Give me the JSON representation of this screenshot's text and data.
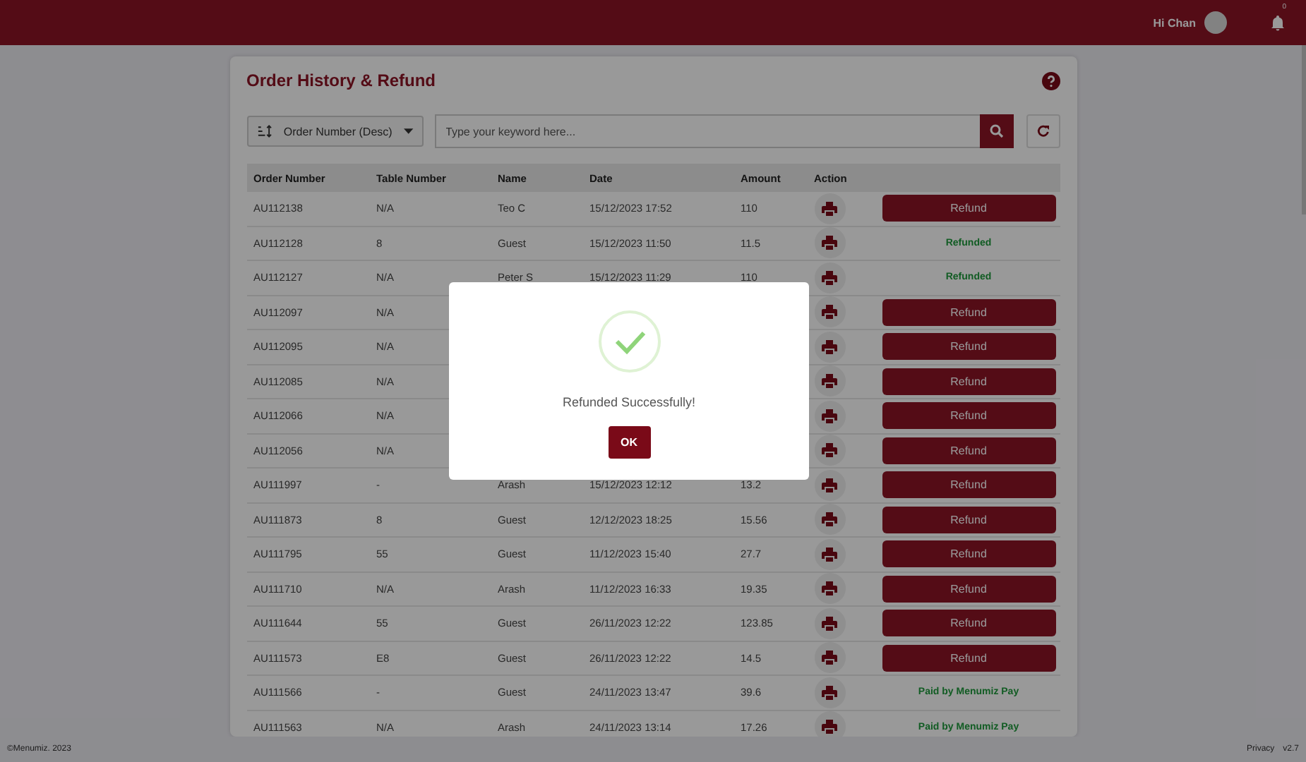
{
  "header": {
    "greeting": "Hi Chan",
    "notification_count": "0"
  },
  "page": {
    "title": "Order History & Refund"
  },
  "toolbar": {
    "sort": "Order Number (Desc)",
    "search_placeholder": "Type your keyword here..."
  },
  "table": {
    "columns": [
      "Order Number",
      "Table Number",
      "Name",
      "Date",
      "Amount",
      "Action"
    ],
    "rows": [
      {
        "order": "AU112138",
        "table": "N/A",
        "name": "Teo C",
        "date": "15/12/2023 17:52",
        "amount": "110",
        "kind": "refund",
        "action": "Refund"
      },
      {
        "order": "AU112128",
        "table": "8",
        "name": "Guest",
        "date": "15/12/2023 11:50",
        "amount": "11.5",
        "kind": "status",
        "action": "Refunded"
      },
      {
        "order": "AU112127",
        "table": "N/A",
        "name": "Peter S",
        "date": "15/12/2023 11:29",
        "amount": "110",
        "kind": "status",
        "action": "Refunded"
      },
      {
        "order": "AU112097",
        "table": "N/A",
        "kind": "refund",
        "action": "Refund"
      },
      {
        "order": "AU112095",
        "table": "N/A",
        "kind": "refund",
        "action": "Refund"
      },
      {
        "order": "AU112085",
        "table": "N/A",
        "kind": "refund",
        "action": "Refund"
      },
      {
        "order": "AU112066",
        "table": "N/A",
        "kind": "refund",
        "action": "Refund"
      },
      {
        "order": "AU112056",
        "table": "N/A",
        "kind": "refund",
        "action": "Refund"
      },
      {
        "order": "AU111997",
        "table": "-",
        "name": "Arash",
        "date": "15/12/2023 12:12",
        "amount": "13.2",
        "kind": "refund",
        "action": "Refund"
      },
      {
        "order": "AU111873",
        "table": "8",
        "name": "Guest",
        "date": "12/12/2023 18:25",
        "amount": "15.56",
        "kind": "refund",
        "action": "Refund"
      },
      {
        "order": "AU111795",
        "table": "55",
        "name": "Guest",
        "date": "11/12/2023 15:40",
        "amount": "27.7",
        "kind": "refund",
        "action": "Refund"
      },
      {
        "order": "AU111710",
        "table": "N/A",
        "name": "Arash",
        "date": "11/12/2023 16:33",
        "amount": "19.35",
        "kind": "refund",
        "action": "Refund"
      },
      {
        "order": "AU111644",
        "table": "55",
        "name": "Guest",
        "date": "26/11/2023 12:22",
        "amount": "123.85",
        "kind": "refund",
        "action": "Refund"
      },
      {
        "order": "AU111573",
        "table": "E8",
        "name": "Guest",
        "date": "26/11/2023 12:22",
        "amount": "14.5",
        "kind": "refund",
        "action": "Refund"
      },
      {
        "order": "AU111566",
        "table": "-",
        "name": "Guest",
        "date": "24/11/2023 13:47",
        "amount": "39.6",
        "kind": "status",
        "action": "Paid by Menumiz Pay"
      },
      {
        "order": "AU111563",
        "table": "N/A",
        "name": "Arash",
        "date": "24/11/2023 13:14",
        "amount": "17.26",
        "kind": "status",
        "action": "Paid by Menumiz Pay"
      }
    ]
  },
  "footer": {
    "copyright": "©Menumiz. 2023",
    "privacy": "Privacy",
    "version": "v2.7"
  },
  "dialog": {
    "message": "Refunded Successfully!",
    "button": "OK"
  }
}
